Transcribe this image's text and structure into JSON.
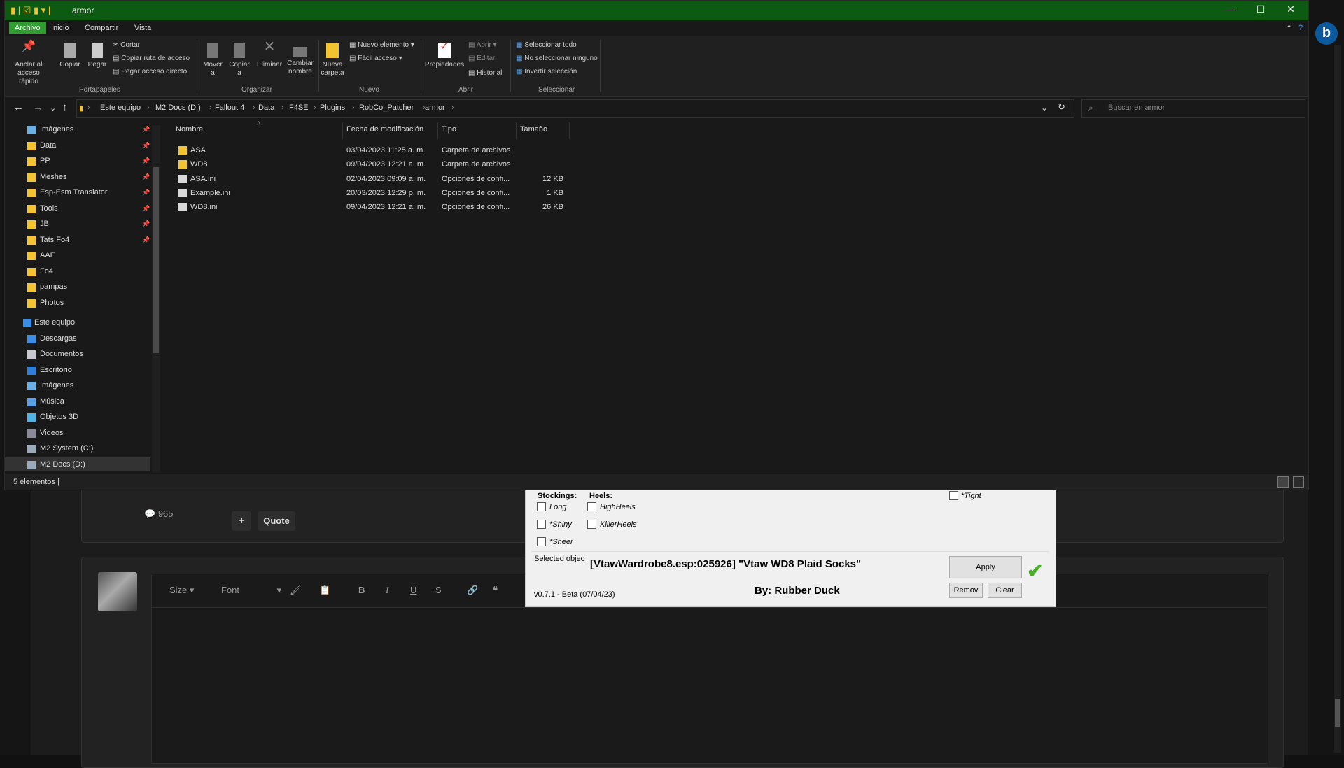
{
  "colors": {
    "titlebar": "#0d5a13",
    "archivo_tab": "#2e9e2e",
    "folder": "#f4c430",
    "accent_check": "#4caf2a"
  },
  "explorer": {
    "title": "armor",
    "window_controls": [
      "—",
      "☐",
      "✕"
    ],
    "menu": [
      "Archivo",
      "Inicio",
      "Compartir",
      "Vista"
    ],
    "ribbon": {
      "anclar": "Anclar al acceso rápido",
      "copiar": "Copiar",
      "pegar": "Pegar",
      "cortar": "Cortar",
      "copiar_ruta": "Copiar ruta de acceso",
      "pegar_acceso": "Pegar acceso directo",
      "group_portapapeles": "Portapapeles",
      "mover": "Mover a",
      "copiar_a": "Copiar a",
      "eliminar": "Eliminar",
      "cambiar": "Cambiar nombre",
      "group_organizar": "Organizar",
      "nueva_carpeta": "Nueva carpeta",
      "nuevo_elemento": "Nuevo elemento",
      "facil_acceso": "Fácil acceso",
      "group_nuevo": "Nuevo",
      "propiedades": "Propiedades",
      "abrir": "Abrir",
      "editar": "Editar",
      "historial": "Historial",
      "group_abrir": "Abrir",
      "seleccionar_todo": "Seleccionar todo",
      "no_seleccionar": "No seleccionar ninguno",
      "invertir": "Invertir selección",
      "group_seleccionar": "Seleccionar"
    },
    "breadcrumbs": [
      "Este equipo",
      "M2 Docs (D:)",
      "Fallout 4",
      "Data",
      "F4SE",
      "Plugins",
      "RobCo_Patcher",
      "armor"
    ],
    "search_placeholder": "Buscar en armor",
    "nav_pinned": [
      {
        "label": "Imágenes",
        "icon": "pictures-icon"
      },
      {
        "label": "Data",
        "icon": "folder-icon"
      },
      {
        "label": "PP",
        "icon": "folder-icon"
      },
      {
        "label": "Meshes",
        "icon": "folder-icon"
      },
      {
        "label": "Esp-Esm Translator",
        "icon": "folder-icon"
      },
      {
        "label": "Tools",
        "icon": "folder-icon"
      },
      {
        "label": "JB",
        "icon": "folder-icon"
      },
      {
        "label": "Tats Fo4",
        "icon": "folder-icon"
      },
      {
        "label": "AAF",
        "icon": "folder-icon"
      },
      {
        "label": "Fo4",
        "icon": "folder-icon"
      },
      {
        "label": "pampas",
        "icon": "folder-icon"
      },
      {
        "label": "Photos",
        "icon": "folder-icon"
      }
    ],
    "nav_this_pc": "Este equipo",
    "nav_pc_items": [
      {
        "label": "Descargas",
        "icon": "downloads-icon"
      },
      {
        "label": "Documentos",
        "icon": "documents-icon"
      },
      {
        "label": "Escritorio",
        "icon": "desktop-icon"
      },
      {
        "label": "Imágenes",
        "icon": "pictures-icon"
      },
      {
        "label": "Música",
        "icon": "music-icon"
      },
      {
        "label": "Objetos 3D",
        "icon": "3d-objects-icon"
      },
      {
        "label": "Videos",
        "icon": "videos-icon"
      },
      {
        "label": "M2 System (C:)",
        "icon": "drive-icon"
      },
      {
        "label": "M2 Docs (D:)",
        "icon": "drive-icon"
      }
    ],
    "columns": [
      "Nombre",
      "Fecha de modificación",
      "Tipo",
      "Tamaño"
    ],
    "files": [
      {
        "name": "ASA",
        "date": "03/04/2023 11:25 a. m.",
        "type": "Carpeta de archivos",
        "size": "",
        "icon": "folder-icon"
      },
      {
        "name": "WD8",
        "date": "09/04/2023 12:21 a. m.",
        "type": "Carpeta de archivos",
        "size": "",
        "icon": "folder-icon"
      },
      {
        "name": "ASA.ini",
        "date": "02/04/2023 09:09 a. m.",
        "type": "Opciones de confi...",
        "size": "12 KB",
        "icon": "ini-file-icon"
      },
      {
        "name": "Example.ini",
        "date": "20/03/2023 12:29 p. m.",
        "type": "Opciones de confi...",
        "size": "1 KB",
        "icon": "ini-file-icon"
      },
      {
        "name": "WD8.ini",
        "date": "09/04/2023 12:21 a. m.",
        "type": "Opciones de confi...",
        "size": "26 KB",
        "icon": "ini-file-icon"
      }
    ],
    "status": "5 elementos"
  },
  "patcher": {
    "stockings_label": "Stockings:",
    "heels_label": "Heels:",
    "stockings": [
      "Long",
      "*Shiny",
      "*Sheer"
    ],
    "heels": [
      "HighHeels",
      "KillerHeels"
    ],
    "tight": "*Tight",
    "selected_label": "Selected objec",
    "selected_value": "[VtawWardrobe8.esp:025926] \"Vtaw WD8 Plaid Socks\"",
    "by": "By: Rubber Duck",
    "version": "v0.7.1 - Beta (07/04/23)",
    "apply": "Apply",
    "remove": "Remov",
    "clear": "Clear",
    "check": "✔"
  },
  "forum": {
    "reaction_count": "965",
    "plus": "+",
    "quote": "Quote",
    "size": "Size",
    "font": "Font",
    "bold": "B",
    "italic": "I",
    "underline": "U",
    "strike": "S"
  }
}
